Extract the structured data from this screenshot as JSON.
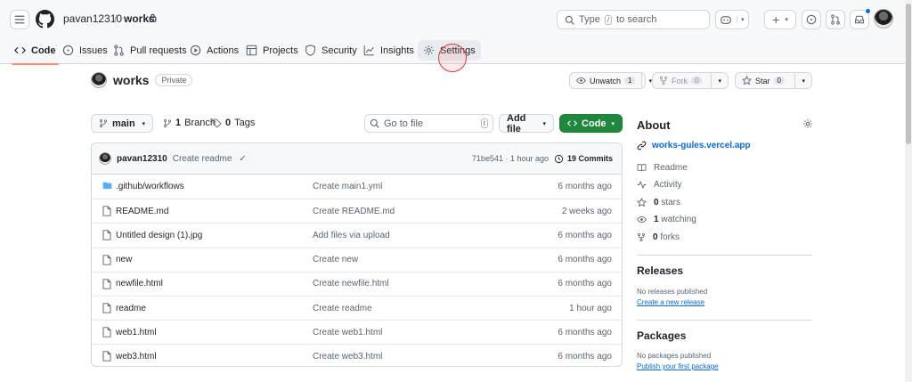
{
  "header": {
    "owner": "pavan12310",
    "separator": "/",
    "repo": "works",
    "search_placeholder_pre": "Type",
    "search_key": "/",
    "search_placeholder_post": "to search"
  },
  "tabs": [
    {
      "label": "Code",
      "icon": "code-icon"
    },
    {
      "label": "Issues",
      "icon": "issue-icon"
    },
    {
      "label": "Pull requests",
      "icon": "pull-request-icon"
    },
    {
      "label": "Actions",
      "icon": "play-icon"
    },
    {
      "label": "Projects",
      "icon": "table-icon"
    },
    {
      "label": "Security",
      "icon": "shield-icon"
    },
    {
      "label": "Insights",
      "icon": "graph-icon"
    },
    {
      "label": "Settings",
      "icon": "gear-icon"
    }
  ],
  "repo": {
    "name": "works",
    "visibility": "Private",
    "unwatch_label": "Unwatch",
    "watch_count": "1",
    "fork_label": "Fork",
    "fork_count": "0",
    "star_label": "Star",
    "star_count": "0"
  },
  "toolbar": {
    "branch": "main",
    "branch_count": "1",
    "branch_label": "Branch",
    "tag_count": "0",
    "tag_label": "Tags",
    "gofile_placeholder": "Go to file",
    "gofile_key": "t",
    "add_file": "Add file",
    "code_button": "Code"
  },
  "commit": {
    "author": "pavan12310",
    "message": "Create readme",
    "hash_time": "71be541 · 1 hour ago",
    "commits": "19 Commits"
  },
  "files": [
    {
      "name": ".github/workflows",
      "type": "folder",
      "message": "Create main1.yml",
      "date": "6 months ago"
    },
    {
      "name": "README.md",
      "type": "file",
      "message": "Create README.md",
      "date": "2 weeks ago"
    },
    {
      "name": "Untitled design (1).jpg",
      "type": "file",
      "message": "Add files via upload",
      "date": "6 months ago"
    },
    {
      "name": "new",
      "type": "file",
      "message": "Create new",
      "date": "6 months ago"
    },
    {
      "name": "newfile.html",
      "type": "file",
      "message": "Create newfile.html",
      "date": "6 months ago"
    },
    {
      "name": "readme",
      "type": "file",
      "message": "Create readme",
      "date": "1 hour ago"
    },
    {
      "name": "web1.html",
      "type": "file",
      "message": "Create web1.html",
      "date": "6 months ago"
    },
    {
      "name": "web3.html",
      "type": "file",
      "message": "Create web3.html",
      "date": "6 months ago"
    }
  ],
  "about": {
    "title": "About",
    "website": "works-gules.vercel.app",
    "readme": "Readme",
    "activity": "Activity",
    "stars_count": "0",
    "stars_label": "stars",
    "watching_count": "1",
    "watching_label": "watching",
    "forks_count": "0",
    "forks_label": "forks"
  },
  "releases": {
    "title": "Releases",
    "empty": "No releases published",
    "link": "Create a new release"
  },
  "packages": {
    "title": "Packages",
    "empty": "No packages published",
    "link": "Publish your first package"
  },
  "colors": {
    "accent_green": "#1f883d",
    "link_blue": "#0969da",
    "tab_underline": "#fd8c73"
  }
}
